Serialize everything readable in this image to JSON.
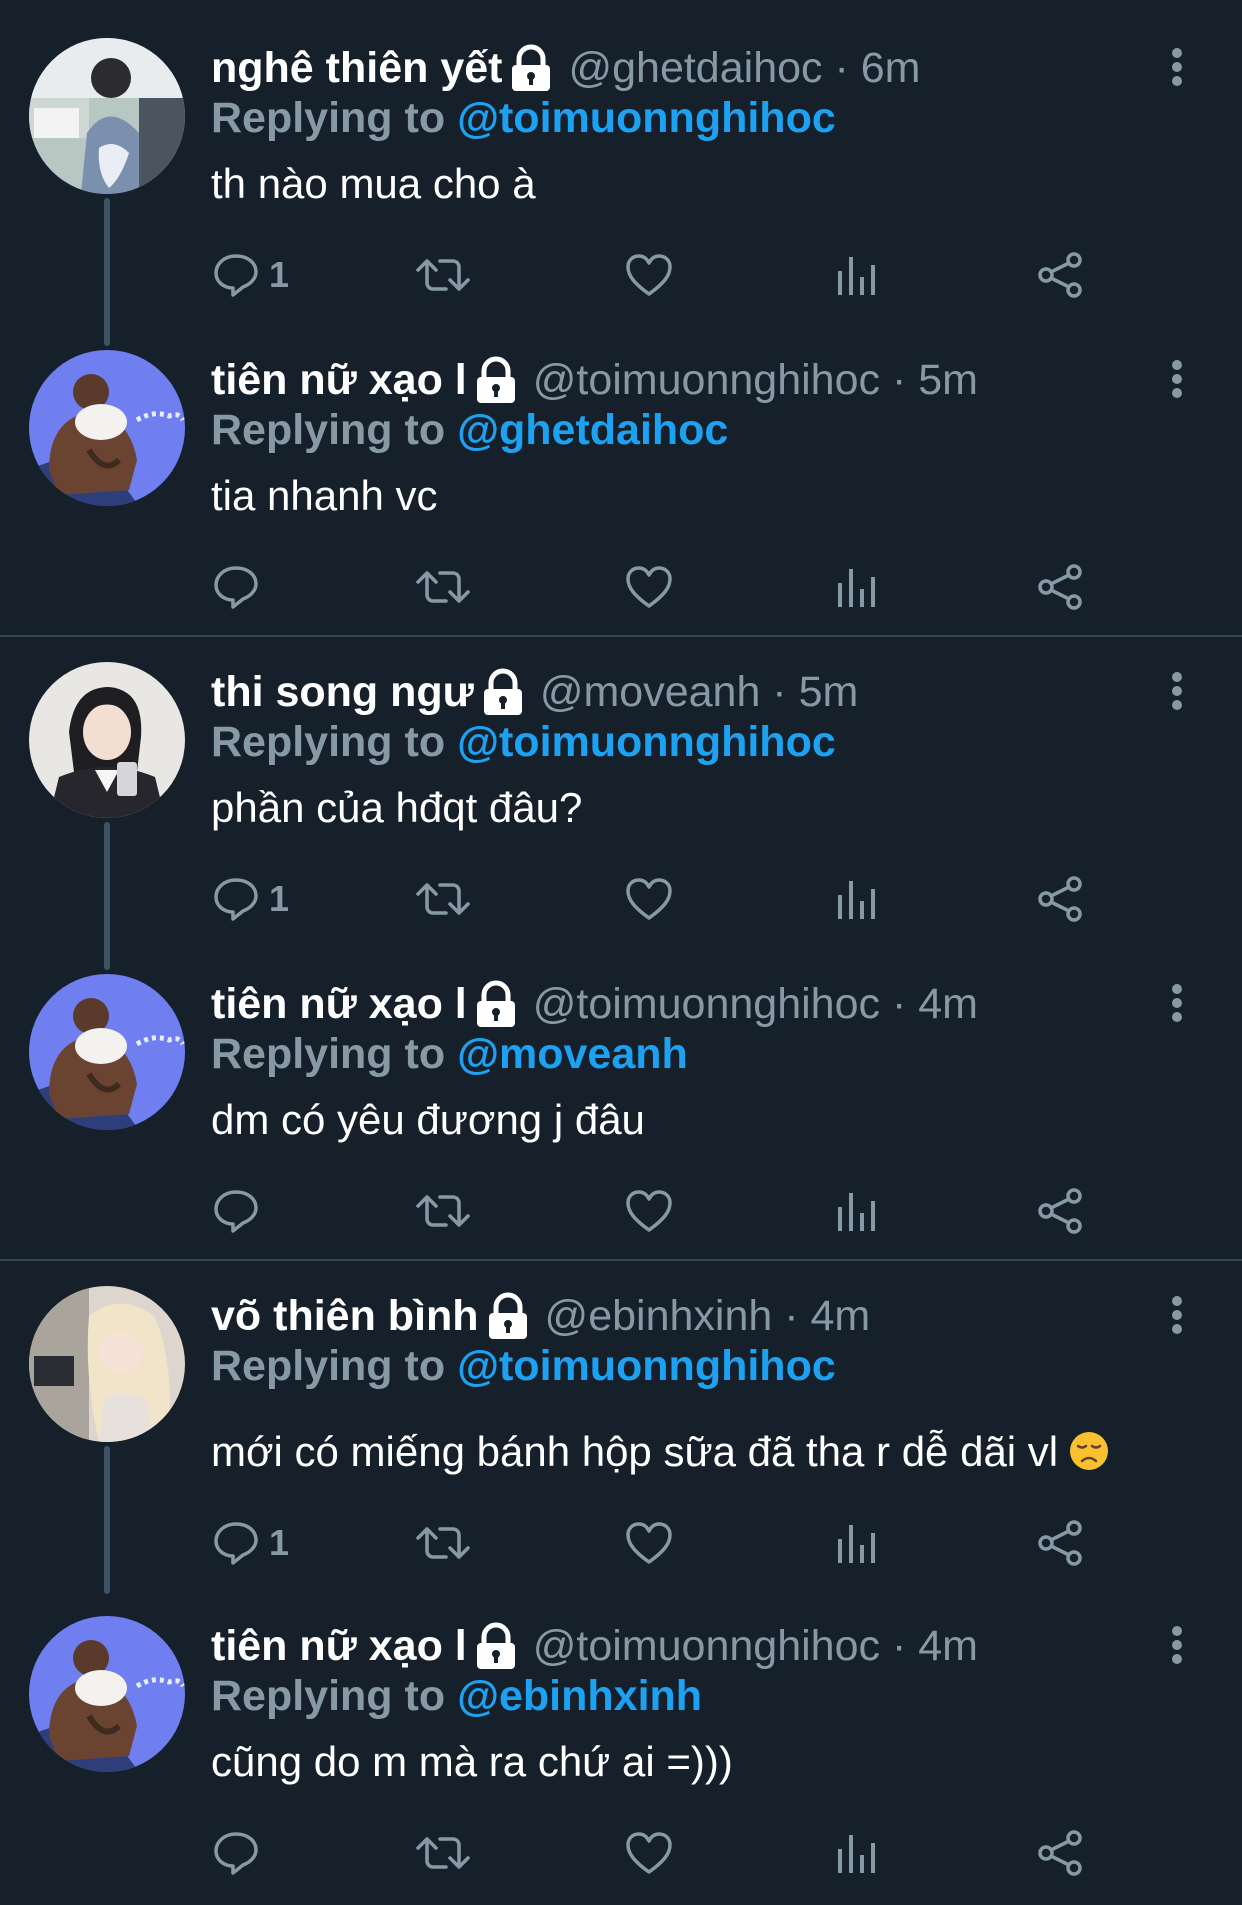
{
  "colors": {
    "background": "#15202b",
    "accent": "#1da1f2",
    "muted": "#8899a6",
    "divider": "#38444d"
  },
  "tweets": [
    {
      "name": "nghê thiên yết",
      "handle": "@ghetdaihoc",
      "time": "6m",
      "replying_label": "Replying to",
      "replying_to": "@toimuonnghihoc",
      "text": "th nào mua cho à",
      "reply_count": "1",
      "locked": true,
      "thread_down": true
    },
    {
      "name": "tiên nữ xạo l",
      "handle": "@toimuonnghihoc",
      "time": "5m",
      "replying_label": "Replying to",
      "replying_to": "@ghetdaihoc",
      "text": "tia nhanh vc",
      "reply_count": "",
      "locked": true,
      "thread_down": false
    },
    {
      "name": "thi song ngư",
      "handle": "@moveanh",
      "time": "5m",
      "replying_label": "Replying to",
      "replying_to": "@toimuonnghihoc",
      "text": "phần của hđqt đâu?",
      "reply_count": "1",
      "locked": true,
      "thread_down": true
    },
    {
      "name": "tiên nữ xạo l",
      "handle": "@toimuonnghihoc",
      "time": "4m",
      "replying_label": "Replying to",
      "replying_to": "@moveanh",
      "text": "dm có yêu đương j đâu",
      "reply_count": "",
      "locked": true,
      "thread_down": false
    },
    {
      "name": "võ thiên bình",
      "handle": "@ebinhxinh",
      "time": "4m",
      "replying_label": "Replying to",
      "replying_to": "@toimuonnghihoc",
      "text": "mới có miếng bánh hộp sữa đã tha r dễ dãi vl",
      "emoji": "disappointed-face",
      "reply_count": "1",
      "locked": true,
      "thread_down": true
    },
    {
      "name": "tiên nữ xạo l",
      "handle": "@toimuonnghihoc",
      "time": "4m",
      "replying_label": "Replying to",
      "replying_to": "@ebinhxinh",
      "text": "cũng do m mà ra chứ ai =)))",
      "reply_count": "",
      "locked": true,
      "thread_down": false
    }
  ],
  "action_icons": [
    "reply-icon",
    "retweet-icon",
    "like-icon",
    "analytics-icon",
    "share-icon"
  ]
}
